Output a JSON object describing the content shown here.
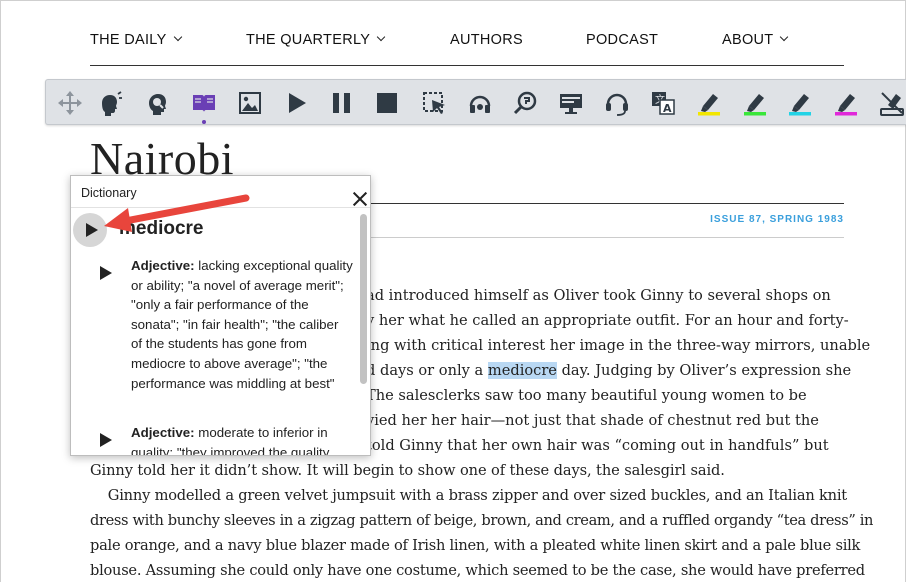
{
  "nav": {
    "items": [
      {
        "label": "THE DAILY",
        "dropdown": true
      },
      {
        "label": "THE QUARTERLY",
        "dropdown": true
      },
      {
        "label": "AUTHORS",
        "dropdown": false
      },
      {
        "label": "PODCAST",
        "dropdown": false
      },
      {
        "label": "ABOUT",
        "dropdown": true
      }
    ]
  },
  "toolbar": {
    "tools": [
      "move-handle-icon",
      "speak-head-icon",
      "picture-dictionary-icon",
      "dictionary-book-icon",
      "image-icon",
      "play-icon",
      "pause-icon",
      "stop-icon",
      "click-to-speak-icon",
      "audio-maker-icon",
      "screenshot-reader-icon",
      "webpage-simplify-icon",
      "headset-icon",
      "translate-icon",
      "highlight-yellow-icon",
      "highlight-green-icon",
      "highlight-cyan-icon",
      "highlight-pink-icon",
      "clear-highlights-icon"
    ],
    "highlight_colors": {
      "yellow": "#f2e600",
      "green": "#39e639",
      "cyan": "#22d3e6",
      "pink": "#e028d9"
    },
    "active_color": "#6a3fb5"
  },
  "article": {
    "title": "Nairobi",
    "issue": "ISSUE 87, SPRING 1983",
    "highlighted_word": "mediocre",
    "lines": [
      {
        "pre": "ad introduced himself as Oliver took Ginny to several shops on",
        "hl": "",
        "post": ""
      },
      {
        "pre": "y her what he called an appropriate outfit. For an hour and forty-",
        "hl": "",
        "post": ""
      },
      {
        "pre": "ing with critical interest her image in the three-way mirrors, unable",
        "hl": "",
        "post": ""
      },
      {
        "pre": "d days or only a ",
        "hl": "mediocre",
        "post": " day. Judging by Oliver’s expression she"
      },
      {
        "pre": " The salesclerks saw too many beautiful young women to be",
        "hl": "",
        "post": ""
      },
      {
        "pre": "vied her her hair—not just that shade of chestnut red but the",
        "hl": "",
        "post": ""
      },
      {
        "pre": "told Ginny that her own hair was “coming out in handfuls” but",
        "hl": "",
        "post": ""
      },
      {
        "pre": "Ginny told her it didn’t show. It will begin to show one of these days, the salesgirl said.",
        "hl": "",
        "post": ""
      },
      {
        "pre": "    Ginny modelled a green velvet jumpsuit with a brass zipper and over sized buckles, and an Italian knit",
        "hl": "",
        "post": ""
      },
      {
        "pre": "dress with bunchy sleeves in a zigzag pattern of beige, brown, and cream, and a ruffled organdy “tea dress” in",
        "hl": "",
        "post": ""
      },
      {
        "pre": "pale orange, and a navy blue blazer made of Irish linen, with a pleated white linen skirt and a pale blue silk",
        "hl": "",
        "post": ""
      },
      {
        "pre": "blouse. Assuming she could only have one costume, which seemed to be the case, she would have preferred",
        "hl": "",
        "post": ""
      }
    ]
  },
  "dictionary": {
    "title": "Dictionary",
    "word": "mediocre",
    "definitions": [
      {
        "pos": "Adjective:",
        "text": " lacking exceptional quality or ability; \"a novel of average merit\"; \"only a fair performance of the sonata\"; \"in fair health\"; \"the caliber of the students has gone from mediocre to above average\"; \"the performance was middling at best\""
      },
      {
        "pos": "Adjective:",
        "text": " moderate to inferior in quality; \"they improved the quality"
      }
    ]
  }
}
